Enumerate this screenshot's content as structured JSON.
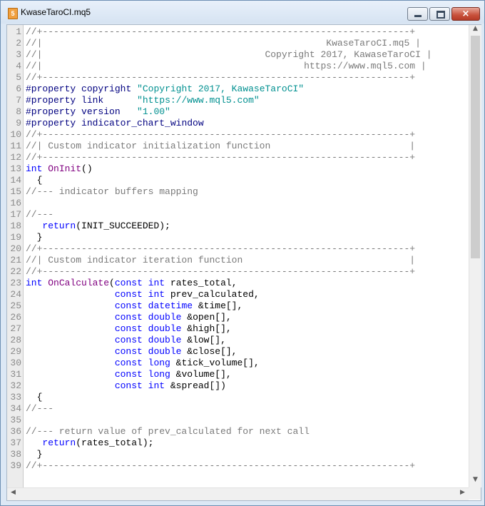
{
  "window": {
    "title": "KwaseTaroCI.mq5",
    "icon": "mq5-file-icon"
  },
  "controls": {
    "minimize": "minimize-icon",
    "maximize": "maximize-icon",
    "close": "×"
  },
  "scrollbars": {
    "up": "▲",
    "down": "▼",
    "left": "◀",
    "right": "▶"
  },
  "code_lines": [
    [
      [
        "c",
        "//+------------------------------------------------------------------+"
      ]
    ],
    [
      [
        "c",
        "//|                                                   KwaseTaroCI.mq5 |"
      ]
    ],
    [
      [
        "c",
        "//|                                        Copyright 2017, KawaseTaroCI |"
      ]
    ],
    [
      [
        "c",
        "//|                                               https://www.mql5.com |"
      ]
    ],
    [
      [
        "c",
        "//+------------------------------------------------------------------+"
      ]
    ],
    [
      [
        "p",
        "#property"
      ],
      [
        "t",
        " "
      ],
      [
        "p",
        "copyright"
      ],
      [
        "t",
        " "
      ],
      [
        "s",
        "\"Copyright 2017, KawaseTaroCI\""
      ]
    ],
    [
      [
        "p",
        "#property"
      ],
      [
        "t",
        " "
      ],
      [
        "p",
        "link"
      ],
      [
        "t",
        "      "
      ],
      [
        "s",
        "\"https://www.mql5.com\""
      ]
    ],
    [
      [
        "p",
        "#property"
      ],
      [
        "t",
        " "
      ],
      [
        "p",
        "version"
      ],
      [
        "t",
        "   "
      ],
      [
        "s",
        "\"1.00\""
      ]
    ],
    [
      [
        "p",
        "#property"
      ],
      [
        "t",
        " "
      ],
      [
        "p",
        "indicator_chart_window"
      ]
    ],
    [
      [
        "c",
        "//+------------------------------------------------------------------+"
      ]
    ],
    [
      [
        "c",
        "//| Custom indicator initialization function                         |"
      ]
    ],
    [
      [
        "c",
        "//+------------------------------------------------------------------+"
      ]
    ],
    [
      [
        "k",
        "int"
      ],
      [
        "t",
        " "
      ],
      [
        "f",
        "OnInit"
      ],
      [
        "t",
        "()"
      ]
    ],
    [
      [
        "t",
        "  {"
      ]
    ],
    [
      [
        "c",
        "//--- indicator buffers mapping"
      ]
    ],
    [
      [
        "t",
        ""
      ]
    ],
    [
      [
        "c",
        "//---"
      ]
    ],
    [
      [
        "t",
        "   "
      ],
      [
        "k",
        "return"
      ],
      [
        "t",
        "(INIT_SUCCEEDED);"
      ]
    ],
    [
      [
        "t",
        "  }"
      ]
    ],
    [
      [
        "c",
        "//+------------------------------------------------------------------+"
      ]
    ],
    [
      [
        "c",
        "//| Custom indicator iteration function                              |"
      ]
    ],
    [
      [
        "c",
        "//+------------------------------------------------------------------+"
      ]
    ],
    [
      [
        "k",
        "int"
      ],
      [
        "t",
        " "
      ],
      [
        "f",
        "OnCalculate"
      ],
      [
        "t",
        "("
      ],
      [
        "k",
        "const"
      ],
      [
        "t",
        " "
      ],
      [
        "k",
        "int"
      ],
      [
        "t",
        " rates_total,"
      ]
    ],
    [
      [
        "t",
        "                "
      ],
      [
        "k",
        "const"
      ],
      [
        "t",
        " "
      ],
      [
        "k",
        "int"
      ],
      [
        "t",
        " prev_calculated,"
      ]
    ],
    [
      [
        "t",
        "                "
      ],
      [
        "k",
        "const"
      ],
      [
        "t",
        " "
      ],
      [
        "k",
        "datetime"
      ],
      [
        "t",
        " &time[],"
      ]
    ],
    [
      [
        "t",
        "                "
      ],
      [
        "k",
        "const"
      ],
      [
        "t",
        " "
      ],
      [
        "k",
        "double"
      ],
      [
        "t",
        " &open[],"
      ]
    ],
    [
      [
        "t",
        "                "
      ],
      [
        "k",
        "const"
      ],
      [
        "t",
        " "
      ],
      [
        "k",
        "double"
      ],
      [
        "t",
        " &high[],"
      ]
    ],
    [
      [
        "t",
        "                "
      ],
      [
        "k",
        "const"
      ],
      [
        "t",
        " "
      ],
      [
        "k",
        "double"
      ],
      [
        "t",
        " &low[],"
      ]
    ],
    [
      [
        "t",
        "                "
      ],
      [
        "k",
        "const"
      ],
      [
        "t",
        " "
      ],
      [
        "k",
        "double"
      ],
      [
        "t",
        " &close[],"
      ]
    ],
    [
      [
        "t",
        "                "
      ],
      [
        "k",
        "const"
      ],
      [
        "t",
        " "
      ],
      [
        "k",
        "long"
      ],
      [
        "t",
        " &tick_volume[],"
      ]
    ],
    [
      [
        "t",
        "                "
      ],
      [
        "k",
        "const"
      ],
      [
        "t",
        " "
      ],
      [
        "k",
        "long"
      ],
      [
        "t",
        " &volume[],"
      ]
    ],
    [
      [
        "t",
        "                "
      ],
      [
        "k",
        "const"
      ],
      [
        "t",
        " "
      ],
      [
        "k",
        "int"
      ],
      [
        "t",
        " &spread[])"
      ]
    ],
    [
      [
        "t",
        "  {"
      ]
    ],
    [
      [
        "c",
        "//---"
      ]
    ],
    [
      [
        "t",
        ""
      ]
    ],
    [
      [
        "c",
        "//--- return value of prev_calculated for next call"
      ]
    ],
    [
      [
        "t",
        "   "
      ],
      [
        "k",
        "return"
      ],
      [
        "t",
        "(rates_total);"
      ]
    ],
    [
      [
        "t",
        "  }"
      ]
    ],
    [
      [
        "c",
        "//+------------------------------------------------------------------+"
      ]
    ]
  ]
}
